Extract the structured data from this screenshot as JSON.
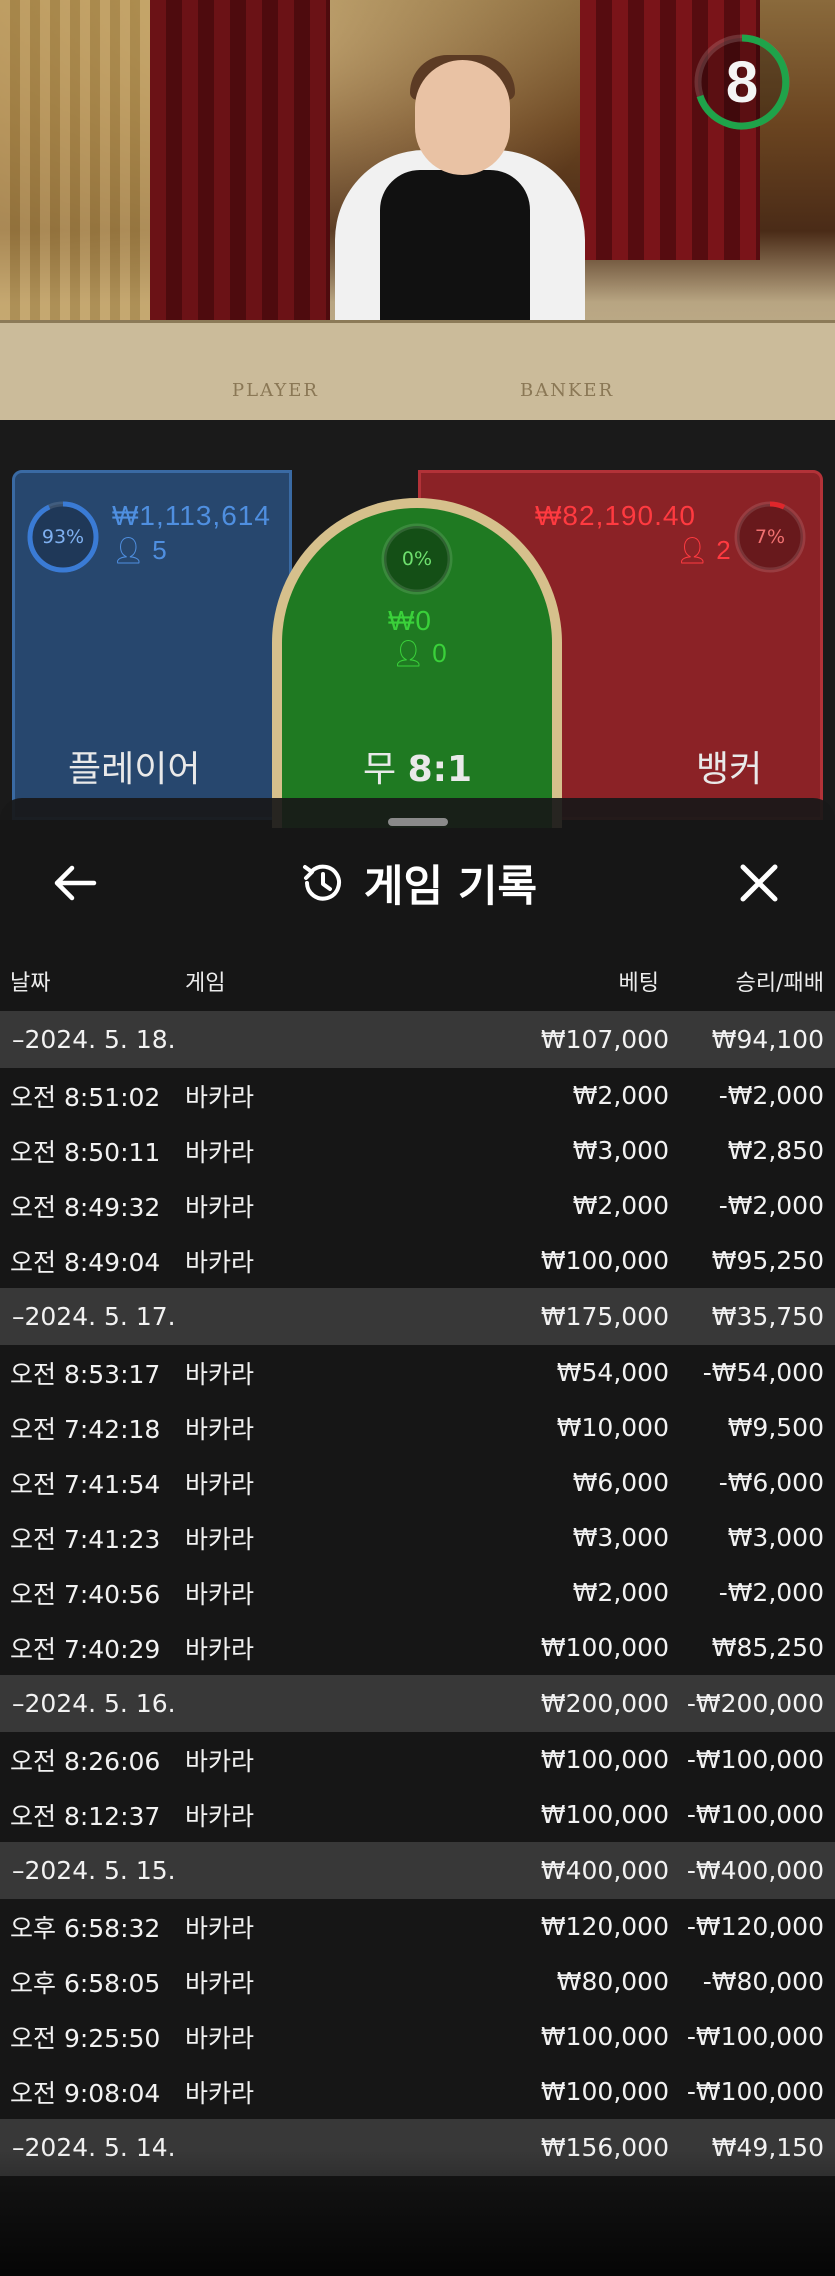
{
  "video": {
    "countdown": "8",
    "felt_player": "PLAYER",
    "felt_banker": "BANKER"
  },
  "bets": {
    "player": {
      "percent": "93%",
      "amount": "₩1,113,614",
      "players": "5",
      "label": "플레이어",
      "color": "#3a7bd5",
      "ratio": 0.93
    },
    "tie": {
      "percent": "0%",
      "amount": "₩0",
      "players": "0",
      "label": "무",
      "payout": "8:1",
      "color": "#2ecc2e",
      "ratio": 0.0
    },
    "banker": {
      "percent": "7%",
      "amount": "₩82,190.40",
      "players": "2",
      "label": "뱅커",
      "color": "#e0262b",
      "ratio": 0.07
    }
  },
  "history": {
    "title": "게임 기록",
    "columns": {
      "date": "날짜",
      "game": "게임",
      "bet": "베팅",
      "result": "승리/패배"
    },
    "rows": [
      {
        "type": "date",
        "label": "–2024. 5. 18.",
        "bet": "₩107,000",
        "result": "₩94,100"
      },
      {
        "type": "entry",
        "time": "오전 8:51:02",
        "game": "바카라",
        "bet": "₩2,000",
        "result": "-₩2,000"
      },
      {
        "type": "entry",
        "time": "오전 8:50:11",
        "game": "바카라",
        "bet": "₩3,000",
        "result": "₩2,850"
      },
      {
        "type": "entry",
        "time": "오전 8:49:32",
        "game": "바카라",
        "bet": "₩2,000",
        "result": "-₩2,000"
      },
      {
        "type": "entry",
        "time": "오전 8:49:04",
        "game": "바카라",
        "bet": "₩100,000",
        "result": "₩95,250"
      },
      {
        "type": "date",
        "label": "–2024. 5. 17.",
        "bet": "₩175,000",
        "result": "₩35,750"
      },
      {
        "type": "entry",
        "time": "오전 8:53:17",
        "game": "바카라",
        "bet": "₩54,000",
        "result": "-₩54,000"
      },
      {
        "type": "entry",
        "time": "오전 7:42:18",
        "game": "바카라",
        "bet": "₩10,000",
        "result": "₩9,500"
      },
      {
        "type": "entry",
        "time": "오전 7:41:54",
        "game": "바카라",
        "bet": "₩6,000",
        "result": "-₩6,000"
      },
      {
        "type": "entry",
        "time": "오전 7:41:23",
        "game": "바카라",
        "bet": "₩3,000",
        "result": "₩3,000"
      },
      {
        "type": "entry",
        "time": "오전 7:40:56",
        "game": "바카라",
        "bet": "₩2,000",
        "result": "-₩2,000"
      },
      {
        "type": "entry",
        "time": "오전 7:40:29",
        "game": "바카라",
        "bet": "₩100,000",
        "result": "₩85,250"
      },
      {
        "type": "date",
        "label": "–2024. 5. 16.",
        "bet": "₩200,000",
        "result": "-₩200,000"
      },
      {
        "type": "entry",
        "time": "오전 8:26:06",
        "game": "바카라",
        "bet": "₩100,000",
        "result": "-₩100,000"
      },
      {
        "type": "entry",
        "time": "오전 8:12:37",
        "game": "바카라",
        "bet": "₩100,000",
        "result": "-₩100,000"
      },
      {
        "type": "date",
        "label": "–2024. 5. 15.",
        "bet": "₩400,000",
        "result": "-₩400,000"
      },
      {
        "type": "entry",
        "time": "오후 6:58:32",
        "game": "바카라",
        "bet": "₩120,000",
        "result": "-₩120,000"
      },
      {
        "type": "entry",
        "time": "오후 6:58:05",
        "game": "바카라",
        "bet": "₩80,000",
        "result": "-₩80,000"
      },
      {
        "type": "entry",
        "time": "오전 9:25:50",
        "game": "바카라",
        "bet": "₩100,000",
        "result": "-₩100,000"
      },
      {
        "type": "entry",
        "time": "오전 9:08:04",
        "game": "바카라",
        "bet": "₩100,000",
        "result": "-₩100,000"
      },
      {
        "type": "date",
        "label": "–2024. 5. 14.",
        "bet": "₩156,000",
        "result": "₩49,150"
      }
    ]
  }
}
